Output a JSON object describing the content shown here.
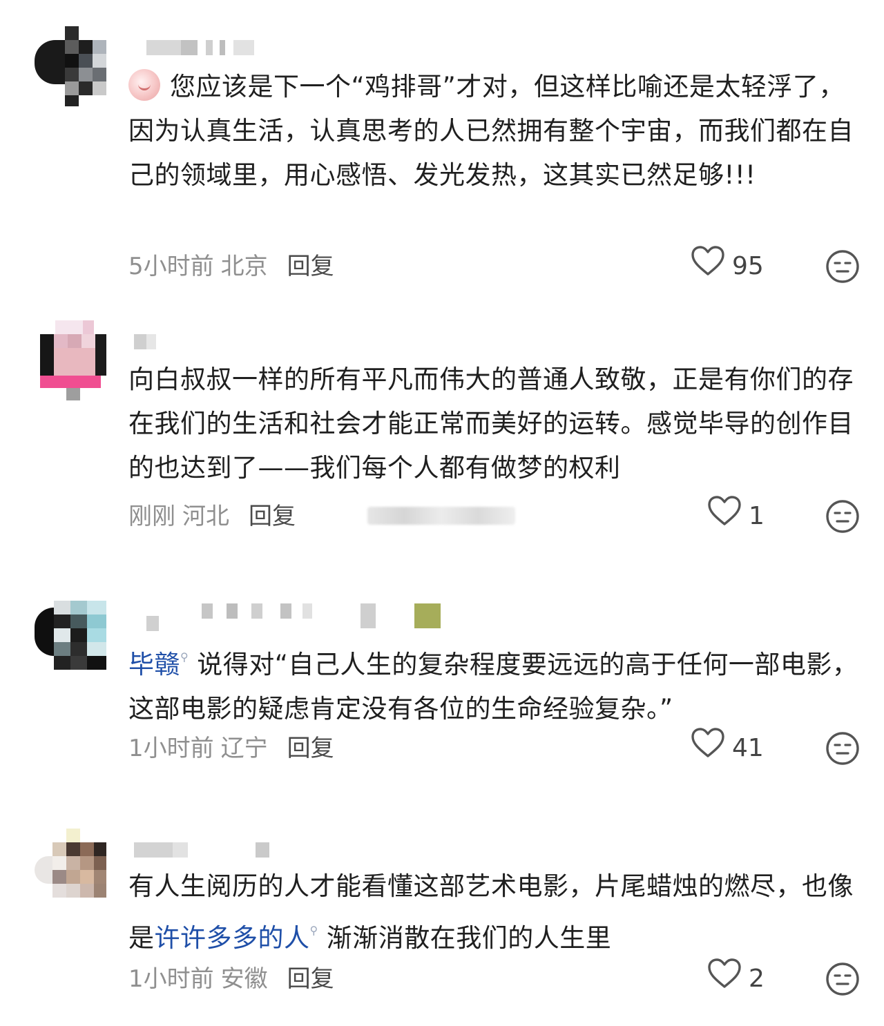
{
  "comments": [
    {
      "id": "c1",
      "text": "您应该是下一个“鸡排哥”才对，但这样比喻还是太轻浮了，因为认真生活，认真思考的人已然拥有整个宇宙，而我们都在自己的领域里，用心感悟、发光发热，这其实已然足够!!!",
      "time": "5小时前",
      "location": "北京",
      "reply": "回复",
      "likes": "95"
    },
    {
      "id": "c2",
      "text": "向白叔叔一样的所有平凡而伟大的普通人致敬，正是有你们的存在我们的生活和社会才能正常而美好的运转。感觉毕导的创作目的也达到了——我们每个人都有做梦的权利",
      "time": "刚刚",
      "location": "河北",
      "reply": "回复",
      "likes": "1"
    },
    {
      "id": "c3",
      "mention": "毕赣",
      "text": "说得对“自己人生的复杂程度要远远的高于任何一部电影，这部电影的疑虑肯定没有各位的生命经验复杂。”",
      "time": "1小时前",
      "location": "辽宁",
      "reply": "回复",
      "likes": "41"
    },
    {
      "id": "c4",
      "text_before": "有人生阅历的人才能看懂这部艺术电影，片尾蜡烛的燃尽，也像是",
      "mention": "许许多多的人",
      "text_after": "渐渐消散在我们的人生里",
      "time": "1小时前",
      "location": "安徽",
      "reply": "回复",
      "likes": "2"
    }
  ],
  "icons": {
    "like": "heart-outline-icon",
    "dislike": "neutral-face-icon",
    "search_hint": "search-icon"
  },
  "colors": {
    "mention": "#1f4fa8",
    "meta_gray": "#8f8f8f",
    "text": "#1f1f1f"
  }
}
